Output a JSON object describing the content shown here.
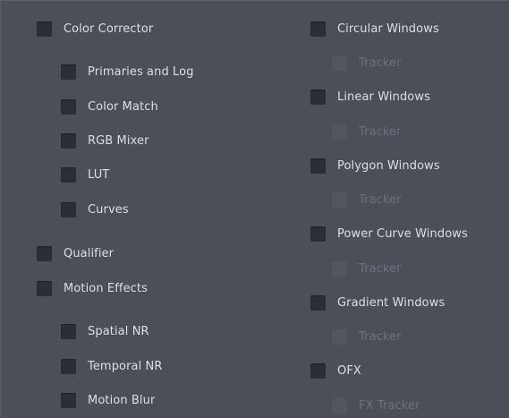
{
  "left_column": {
    "color_corrector": "Color Corrector",
    "primaries_and_log": "Primaries and Log",
    "color_match": "Color Match",
    "rgb_mixer": "RGB Mixer",
    "lut": "LUT",
    "curves": "Curves",
    "qualifier": "Qualifier",
    "motion_effects": "Motion Effects",
    "spatial_nr": "Spatial NR",
    "temporal_nr": "Temporal NR",
    "motion_blur": "Motion Blur"
  },
  "right_column": {
    "circular_windows": "Circular Windows",
    "circular_tracker": "Tracker",
    "linear_windows": "Linear Windows",
    "linear_tracker": "Tracker",
    "polygon_windows": "Polygon Windows",
    "polygon_tracker": "Tracker",
    "power_curve_windows": "Power Curve Windows",
    "power_curve_tracker": "Tracker",
    "gradient_windows": "Gradient Windows",
    "gradient_tracker": "Tracker",
    "ofx": "OFX",
    "fx_tracker": "FX Tracker"
  },
  "checkbox_state": {
    "checked": false
  },
  "colors": {
    "panel_background": "#4a4f58",
    "checkbox_fill": "#2b2e34",
    "label_text": "#dcdfe5",
    "disabled_text": "#6c717c"
  }
}
